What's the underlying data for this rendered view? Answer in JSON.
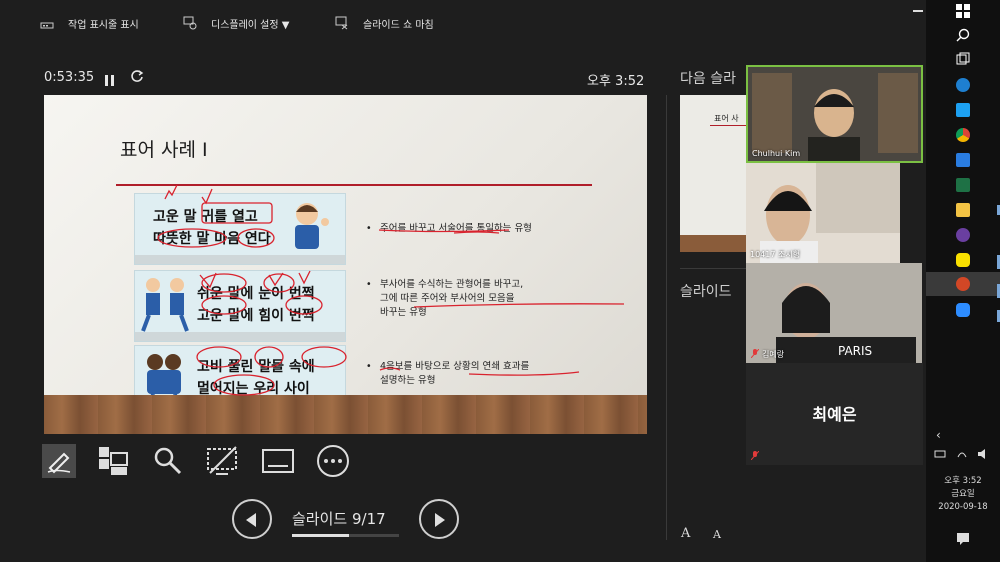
{
  "toolbar": {
    "show_taskbar": "작업 표시줄 표시",
    "display_settings": "디스플레이 설정 ▼",
    "end_slideshow": "슬라이드 쇼 마침"
  },
  "presenter": {
    "timer": "0:53:35",
    "clock": "오후 3:52",
    "slide_counter": "슬라이드 9/17",
    "progress": 0.53,
    "next_label": "다음 슬라",
    "notes_label": "슬라이드",
    "font_up": "A",
    "font_down": "A"
  },
  "slide": {
    "title": "표어 사례 I",
    "cartoons": [
      {
        "line1": "고운 말 귀를 열고",
        "line2": "따뜻한 말 마음 연다"
      },
      {
        "line1": "쉬운 말에 눈이 번쩍",
        "line2": "고운 말에 힘이 번쩍"
      },
      {
        "line1": "고비 풀린 말들 속에",
        "line2": "멀어지는 우리 사이"
      }
    ],
    "bullets": [
      [
        "주어를 바꾸고 서술어를 통일하는 유형"
      ],
      [
        "부사어를 수식하는 관형어를 바꾸고,",
        "그에 따른 주어와 부사어의 모음을",
        "바꾸는 유형"
      ],
      [
        "4음보를 바탕으로 상황의 연쇄 효과를",
        "설명하는 유형"
      ]
    ],
    "bullet_mark": "•"
  },
  "next_slide": {
    "title": "표어 사"
  },
  "participants": [
    {
      "name": "Chulhui Kim",
      "muted": false
    },
    {
      "name": "10417 조시형",
      "muted": false
    },
    {
      "name": "김예랑",
      "muted": true
    },
    {
      "name": "최예은",
      "muted": true
    }
  ],
  "tray": {
    "time": "오후 3:52",
    "day": "금요일",
    "date": "2020-09-18"
  },
  "colors": {
    "ink": "#d9232e",
    "slide_line": "#b01e2a",
    "active_speaker": "#7bc043"
  }
}
